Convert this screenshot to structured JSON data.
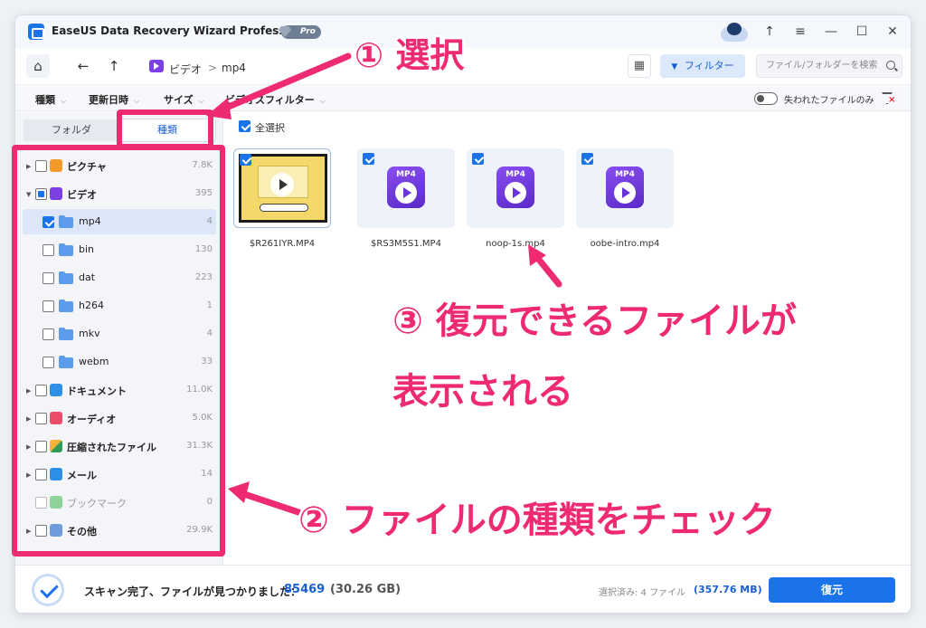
{
  "titlebar": {
    "app_title": "EaseUS Data Recovery Wizard Professional",
    "badge": "Pro",
    "controls": [
      "↑",
      "≡",
      "—",
      "☐",
      "✕"
    ]
  },
  "nav": {
    "home": "⌂",
    "back": "←",
    "up": "↑",
    "path": [
      "ビデオ",
      "mp4"
    ],
    "path_sep": ">",
    "grid": "▦",
    "filter_label": "フィルター",
    "filter_icon": "▼",
    "search_placeholder": "ファイル/フォルダーを検索"
  },
  "filterbar": {
    "items": [
      "種類",
      "更新日時",
      "サイズ",
      "ビデオスフィルター"
    ],
    "lost_only": "失われたファイルのみ"
  },
  "sidebar": {
    "tabs": [
      "フォルダ",
      "種類"
    ],
    "tree": [
      {
        "label": "ピクチャ",
        "count": "7.8K"
      },
      {
        "label": "ビデオ",
        "count": "395"
      },
      {
        "label": "mp4",
        "count": "4"
      },
      {
        "label": "bin",
        "count": "130"
      },
      {
        "label": "dat",
        "count": "223"
      },
      {
        "label": "h264",
        "count": "1"
      },
      {
        "label": "mkv",
        "count": "4"
      },
      {
        "label": "webm",
        "count": "33"
      },
      {
        "label": "ドキュメント",
        "count": "11.0K"
      },
      {
        "label": "オーディオ",
        "count": "5.0K"
      },
      {
        "label": "圧縮されたファイル",
        "count": "31.3K"
      },
      {
        "label": "メール",
        "count": "14"
      },
      {
        "label": "ブックマーク",
        "count": "0"
      },
      {
        "label": "その他",
        "count": "29.9K"
      }
    ]
  },
  "content": {
    "select_all": "全選択",
    "files": [
      {
        "name": "$R261IYR.MP4",
        "badge": "MP4"
      },
      {
        "name": "$RS3M5S1.MP4",
        "badge": "MP4"
      },
      {
        "name": "noop-1s.mp4",
        "badge": "MP4"
      },
      {
        "name": "oobe-intro.mp4",
        "badge": "MP4"
      }
    ]
  },
  "status": {
    "text": "スキャン完了、ファイルが見つかりました：",
    "count": "85469",
    "size": "(30.26 GB)",
    "selected": "選択済み: 4 ファイル",
    "selected_size": "(357.76 MB)",
    "recover": "復元"
  },
  "annotations": {
    "a1": "① 選択",
    "a2": "② ファイルの種類をチェック",
    "a3_line1": "③ 復元できるファイルが",
    "a3_line2": "表示される",
    "color": "#ee2a73"
  }
}
